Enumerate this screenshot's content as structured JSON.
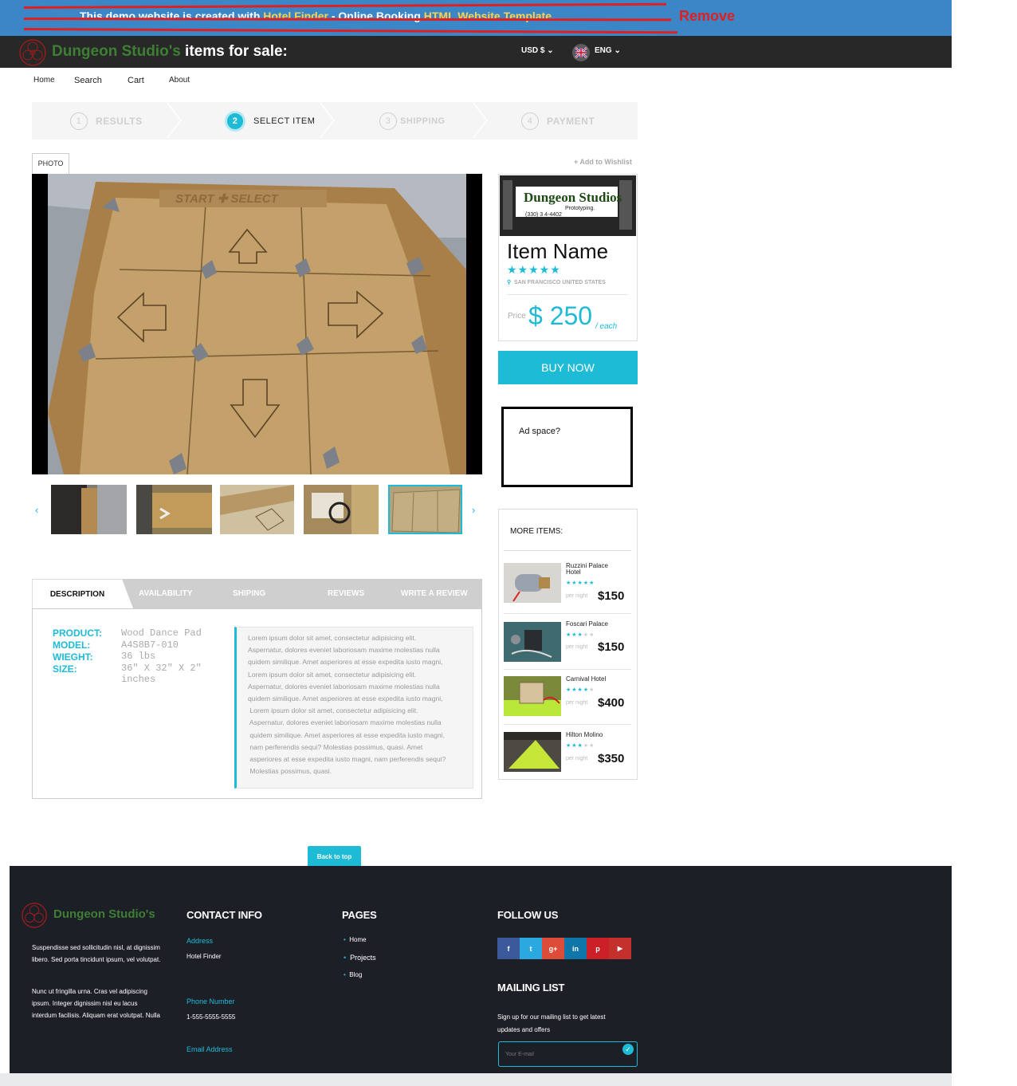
{
  "demo_banner": {
    "prefix": "This demo website is created with ",
    "link1": "Hotel Finder",
    "mid": " - Online Booking ",
    "link2": "HTML Website Template.",
    "annotation": "Remove"
  },
  "header": {
    "brand": "Dungeon Studio's",
    "brand_suffix": " items for sale:",
    "currency": "USD $",
    "language": "ENG"
  },
  "nav": [
    "Home",
    "Search",
    "Cart",
    "About"
  ],
  "steps": [
    {
      "num": "1",
      "label": "RESULTS"
    },
    {
      "num": "2",
      "label": "SELECT ITEM"
    },
    {
      "num": "3",
      "label": "SHIPPING"
    },
    {
      "num": "4",
      "label": "PAYMENT"
    }
  ],
  "photo_tab": "PHOTO",
  "wishlist": "+ Add to Wishlist",
  "card": {
    "logo_title": "Dungeon Studios",
    "logo_sub": "Prototyping.",
    "logo_phone": "(330) 3 4-4402",
    "item_name": "Item Name",
    "stars": "★★★★★",
    "location": "SAN FRANCISCO UNITED STATES",
    "price_label": "Price",
    "price": "$ 250",
    "price_unit": "/ each",
    "buy": "BUY NOW"
  },
  "ad": "Ad space?",
  "more_items": {
    "title": "MORE ITEMS:",
    "items": [
      {
        "name": "Ruzzini Palace Hotel",
        "stars_on": "★★★★★",
        "stars_off": "",
        "per": "per night",
        "price": "$150"
      },
      {
        "name": "Foscari Palace",
        "stars_on": "★★★",
        "stars_off": "★★",
        "per": "per night",
        "price": "$150"
      },
      {
        "name": "Carnival Hotel",
        "stars_on": "★★★★",
        "stars_off": "★",
        "per": "per night",
        "price": "$400"
      },
      {
        "name": "Hilton Molino",
        "stars_on": "★★★",
        "stars_off": "★★",
        "per": "per night",
        "price": "$350"
      }
    ]
  },
  "tabs": [
    "DESCRIPTION",
    "AVAILABILITY",
    "SHIPING",
    "REVIEWS",
    "WRITE A REVIEW"
  ],
  "specs": {
    "keys": [
      "PRODUCT:",
      "MODEL:",
      "WIEGHT:",
      "SIZE:"
    ],
    "values": [
      "Wood Dance Pad",
      "A4S8B7-010",
      "36 lbs",
      "36\" X 32\" X 2\"",
      "inches"
    ]
  },
  "description": [
    "Lorem ipsum dolor sit amet, consectetur adipisicing elit.",
    "Aspernatur, dolores eveniet laboriosam maxime molestias nulla",
    "quidem similique. Amet asperiores at esse expedita iusto magni,",
    "Lorem ipsum dolor sit amet, consectetur adipisicing elit.",
    "Aspernatur, dolores eveniet laboriosam maxime molestias nulla",
    "quidem similique. Amet asperiores at esse expedita iusto magni,",
    " Lorem ipsum dolor sit amet, consectetur adipisicing elit.",
    " Aspernatur, dolores eveniet laboriosam maxime molestias nulla",
    " quidem similique. Amet asperiores at esse expedita iusto magni,",
    " nam perferendis sequi? Molestias possimus, quasi. Amet",
    " asperiores at esse expedita iusto magni, nam perferendis sequi?",
    " Molestias possimus, quasi."
  ],
  "back_to_top": "Back to top",
  "footer": {
    "brand": "Dungeon Studio's",
    "about1": [
      "Suspendisse sed sollicitudin nisl, at dignissim",
      "libero. Sed porta tincidunt ipsum, vel volutpat."
    ],
    "about2": [
      "Nunc ut fringilla urna. Cras vel adipiscing",
      "ipsum. Integer dignissim nisl eu lacus",
      "interdum facilisis. Aliquam erat volutpat. Nulla"
    ],
    "contact_title": "CONTACT INFO",
    "address_label": "Address",
    "address": "Hotel Finder",
    "phone_label": "Phone Number",
    "phone": "1-555-5555-5555",
    "email_label": "Email Address",
    "pages_title": "PAGES",
    "pages": [
      "Home",
      "Projects",
      "Blog"
    ],
    "follow_title": "FOLLOW US",
    "social": [
      {
        "icon": "facebook-icon",
        "glyph": "f",
        "color": "#3b5998"
      },
      {
        "icon": "twitter-icon",
        "glyph": "t",
        "color": "#2aa9e0"
      },
      {
        "icon": "google-plus-icon",
        "glyph": "g+",
        "color": "#dd4b39"
      },
      {
        "icon": "linkedin-icon",
        "glyph": "in",
        "color": "#0e76a8"
      },
      {
        "icon": "pinterest-icon",
        "glyph": "p",
        "color": "#cb2027"
      },
      {
        "icon": "youtube-icon",
        "glyph": "▶",
        "color": "#c4302b"
      }
    ],
    "mailing_title": "MAILING LIST",
    "mailing_text": [
      "Sign up for our mailing list to get latest",
      "updates and offers"
    ],
    "email_placeholder": "Your E-mail"
  },
  "colors": {
    "accent": "#1ebbd7",
    "brand_green": "#3d7f33",
    "banner_blue": "#3b86c6",
    "footer_bg": "#1d1f27",
    "annotation_red": "#e02020"
  }
}
